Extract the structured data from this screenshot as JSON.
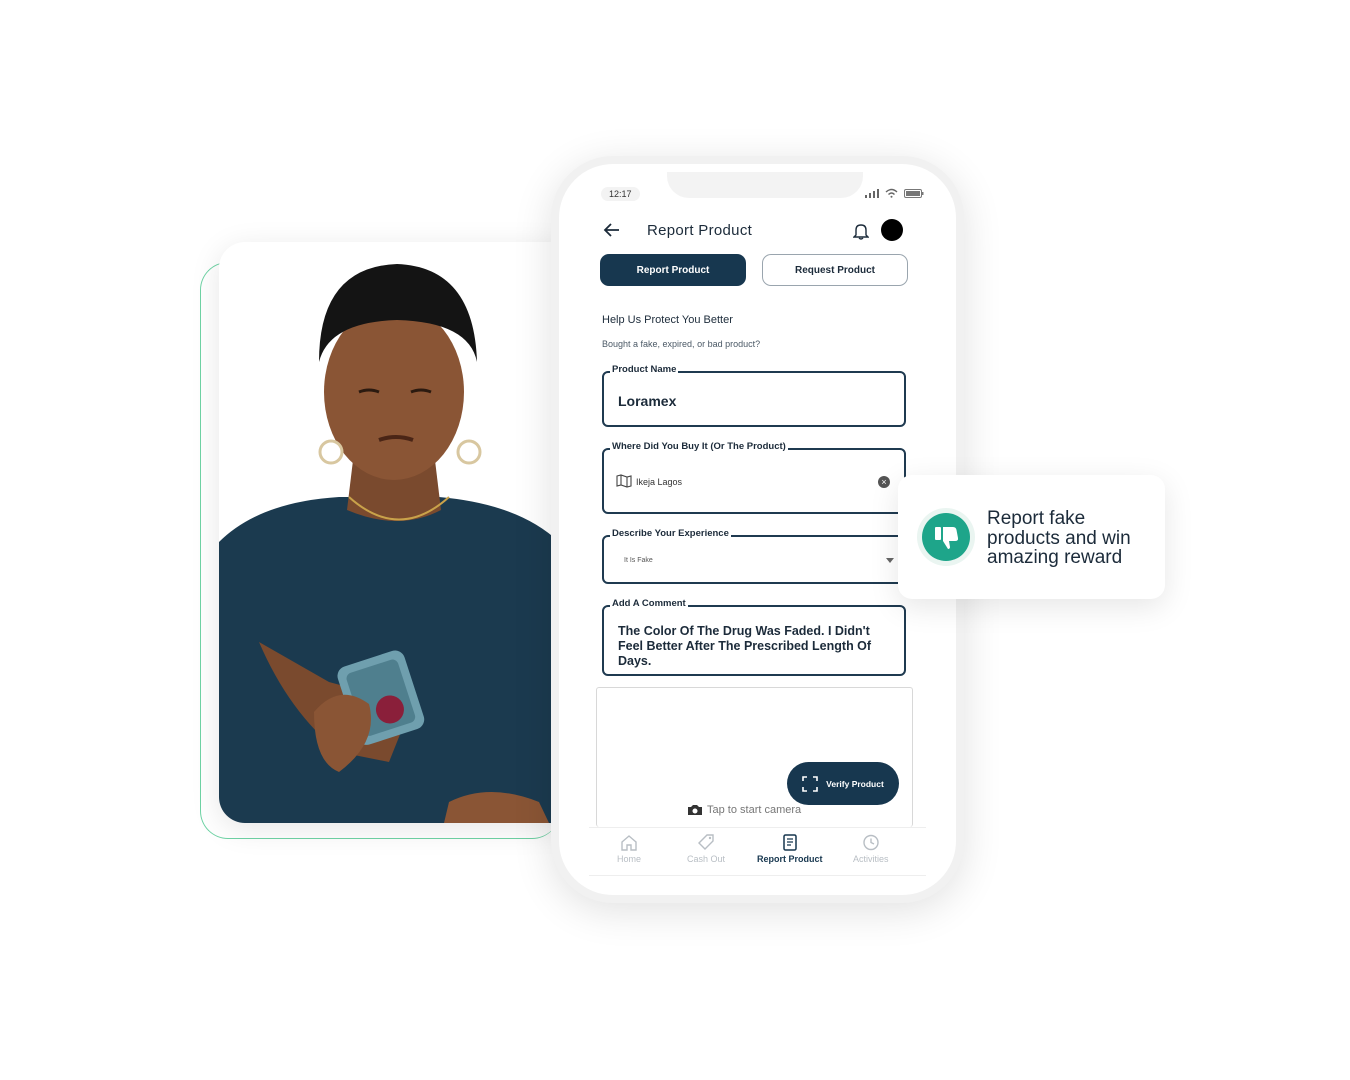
{
  "status_bar": {
    "time": "12:17"
  },
  "header": {
    "title": "Report Product"
  },
  "tabs": [
    {
      "label": "Report Product",
      "active": true
    },
    {
      "label": "Request Product",
      "active": false
    }
  ],
  "intro": {
    "title": "Help Us Protect You Better",
    "subtitle": "Bought a fake, expired, or bad product?"
  },
  "form": {
    "product_name": {
      "label": "Product Name",
      "value": "Loramex"
    },
    "where_bought": {
      "label": "Where Did You Buy It (Or The Product)",
      "value": "Ikeja Lagos"
    },
    "experience": {
      "label": "Describe Your Experience",
      "value": "It Is Fake"
    },
    "comment": {
      "label": "Add A Comment",
      "value": "The Color Of The Drug Was Faded. I Didn't Feel Better After The Prescribed Length Of Days."
    }
  },
  "camera": {
    "hint": "Tap to start camera",
    "verify_label": "Verify Product"
  },
  "bottom_nav": [
    {
      "label": "Home",
      "icon": "home-icon",
      "active": false
    },
    {
      "label": "Cash Out",
      "icon": "tag-icon",
      "active": false
    },
    {
      "label": "Report Product",
      "icon": "document-icon",
      "active": true
    },
    {
      "label": "Activities",
      "icon": "clock-icon",
      "active": false
    }
  ],
  "promo": {
    "text": "Report fake products and win amazing reward",
    "icon": "thumbs-down-icon"
  },
  "colors": {
    "primary": "#17374f",
    "accent": "#1ea58a",
    "outline": "#6fd3a5"
  }
}
